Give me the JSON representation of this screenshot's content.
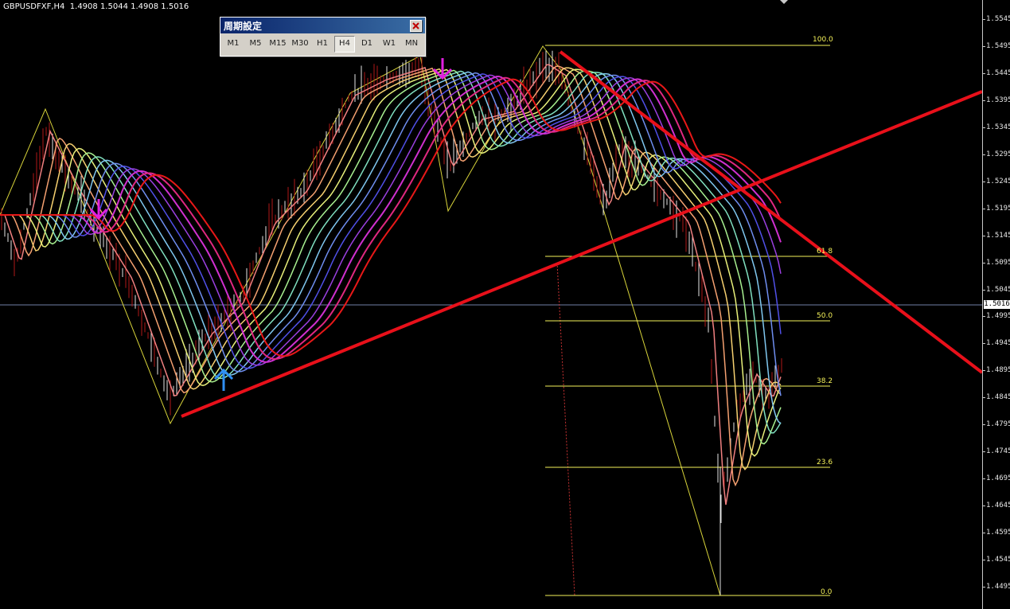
{
  "symbol_info": "GBPUSDFXF,H4  1.4908 1.5044 1.4908 1.5016",
  "current_price": "1.5016",
  "period_window": {
    "title": "周期設定",
    "close_icon": "close-icon",
    "buttons": [
      "M1",
      "M5",
      "M15",
      "M30",
      "H1",
      "H4",
      "D1",
      "W1",
      "MN"
    ],
    "active": "H4"
  },
  "colors": {
    "background": "#000000",
    "trendline": "#e8101a",
    "fib": "#f5f25a",
    "arrow_down": "#e020e0",
    "arrow_up": "#2f8ef2"
  },
  "chart_data": {
    "type": "line",
    "price_axis_ticks": [
      "1.5545",
      "1.5495",
      "1.5445",
      "1.5395",
      "1.5345",
      "1.5295",
      "1.5245",
      "1.5195",
      "1.5145",
      "1.5095",
      "1.5045",
      "1.4995",
      "1.4945",
      "1.4895",
      "1.4845",
      "1.4795",
      "1.4745",
      "1.4695",
      "1.4645",
      "1.4595",
      "1.4545",
      "1.4495"
    ],
    "ylim": [
      1.4475,
      1.5565
    ],
    "fibonacci_levels": [
      "100.0",
      "61.8",
      "50.0",
      "38.2",
      "23.6",
      "0.0"
    ]
  }
}
